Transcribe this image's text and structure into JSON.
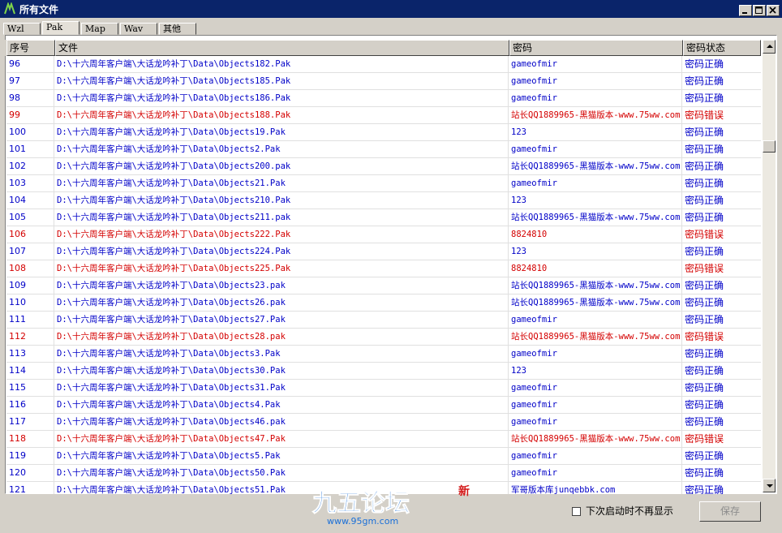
{
  "window": {
    "title": "所有文件"
  },
  "tabs": [
    "Wzl",
    "Pak",
    "Map",
    "Wav",
    "其他"
  ],
  "active_tab": 1,
  "columns": [
    "序号",
    "文件",
    "密码",
    "密码状态"
  ],
  "colors": {
    "ok": "#0000c8",
    "bad": "#d40000"
  },
  "rows": [
    {
      "no": "96",
      "file": "D:\\十六周年客户端\\大话龙吟补丁\\Data\\Objects182.Pak",
      "pwd": "gameofmir",
      "status": "密码正确",
      "ok": true
    },
    {
      "no": "97",
      "file": "D:\\十六周年客户端\\大话龙吟补丁\\Data\\Objects185.Pak",
      "pwd": "gameofmir",
      "status": "密码正确",
      "ok": true
    },
    {
      "no": "98",
      "file": "D:\\十六周年客户端\\大话龙吟补丁\\Data\\Objects186.Pak",
      "pwd": "gameofmir",
      "status": "密码正确",
      "ok": true
    },
    {
      "no": "99",
      "file": "D:\\十六周年客户端\\大话龙吟补丁\\Data\\Objects188.Pak",
      "pwd": "站长QQ1889965-黑猫版本-www.75ww.com",
      "status": "密码错误",
      "ok": false
    },
    {
      "no": "100",
      "file": "D:\\十六周年客户端\\大话龙吟补丁\\Data\\Objects19.Pak",
      "pwd": "123",
      "status": "密码正确",
      "ok": true
    },
    {
      "no": "101",
      "file": "D:\\十六周年客户端\\大话龙吟补丁\\Data\\Objects2.Pak",
      "pwd": "gameofmir",
      "status": "密码正确",
      "ok": true
    },
    {
      "no": "102",
      "file": "D:\\十六周年客户端\\大话龙吟补丁\\Data\\Objects200.pak",
      "pwd": "站长QQ1889965-黑猫版本-www.75ww.com",
      "status": "密码正确",
      "ok": true
    },
    {
      "no": "103",
      "file": "D:\\十六周年客户端\\大话龙吟补丁\\Data\\Objects21.Pak",
      "pwd": "gameofmir",
      "status": "密码正确",
      "ok": true
    },
    {
      "no": "104",
      "file": "D:\\十六周年客户端\\大话龙吟补丁\\Data\\Objects210.Pak",
      "pwd": "123",
      "status": "密码正确",
      "ok": true
    },
    {
      "no": "105",
      "file": "D:\\十六周年客户端\\大话龙吟补丁\\Data\\Objects211.pak",
      "pwd": "站长QQ1889965-黑猫版本-www.75ww.com",
      "status": "密码正确",
      "ok": true
    },
    {
      "no": "106",
      "file": "D:\\十六周年客户端\\大话龙吟补丁\\Data\\Objects222.Pak",
      "pwd": "8824810",
      "status": "密码错误",
      "ok": false
    },
    {
      "no": "107",
      "file": "D:\\十六周年客户端\\大话龙吟补丁\\Data\\Objects224.Pak",
      "pwd": "123",
      "status": "密码正确",
      "ok": true
    },
    {
      "no": "108",
      "file": "D:\\十六周年客户端\\大话龙吟补丁\\Data\\Objects225.Pak",
      "pwd": "8824810",
      "status": "密码错误",
      "ok": false
    },
    {
      "no": "109",
      "file": "D:\\十六周年客户端\\大话龙吟补丁\\Data\\Objects23.pak",
      "pwd": "站长QQ1889965-黑猫版本-www.75ww.com",
      "status": "密码正确",
      "ok": true
    },
    {
      "no": "110",
      "file": "D:\\十六周年客户端\\大话龙吟补丁\\Data\\Objects26.pak",
      "pwd": "站长QQ1889965-黑猫版本-www.75ww.com",
      "status": "密码正确",
      "ok": true
    },
    {
      "no": "111",
      "file": "D:\\十六周年客户端\\大话龙吟补丁\\Data\\Objects27.Pak",
      "pwd": "gameofmir",
      "status": "密码正确",
      "ok": true
    },
    {
      "no": "112",
      "file": "D:\\十六周年客户端\\大话龙吟补丁\\Data\\Objects28.pak",
      "pwd": "站长QQ1889965-黑猫版本-www.75ww.com",
      "status": "密码错误",
      "ok": false
    },
    {
      "no": "113",
      "file": "D:\\十六周年客户端\\大话龙吟补丁\\Data\\Objects3.Pak",
      "pwd": "gameofmir",
      "status": "密码正确",
      "ok": true
    },
    {
      "no": "114",
      "file": "D:\\十六周年客户端\\大话龙吟补丁\\Data\\Objects30.Pak",
      "pwd": "123",
      "status": "密码正确",
      "ok": true
    },
    {
      "no": "115",
      "file": "D:\\十六周年客户端\\大话龙吟补丁\\Data\\Objects31.Pak",
      "pwd": "gameofmir",
      "status": "密码正确",
      "ok": true
    },
    {
      "no": "116",
      "file": "D:\\十六周年客户端\\大话龙吟补丁\\Data\\Objects4.Pak",
      "pwd": "gameofmir",
      "status": "密码正确",
      "ok": true
    },
    {
      "no": "117",
      "file": "D:\\十六周年客户端\\大话龙吟补丁\\Data\\Objects46.pak",
      "pwd": "gameofmir",
      "status": "密码正确",
      "ok": true
    },
    {
      "no": "118",
      "file": "D:\\十六周年客户端\\大话龙吟补丁\\Data\\Objects47.Pak",
      "pwd": "站长QQ1889965-黑猫版本-www.75ww.com",
      "status": "密码错误",
      "ok": false
    },
    {
      "no": "119",
      "file": "D:\\十六周年客户端\\大话龙吟补丁\\Data\\Objects5.Pak",
      "pwd": "gameofmir",
      "status": "密码正确",
      "ok": true
    },
    {
      "no": "120",
      "file": "D:\\十六周年客户端\\大话龙吟补丁\\Data\\Objects50.Pak",
      "pwd": "gameofmir",
      "status": "密码正确",
      "ok": true
    },
    {
      "no": "121",
      "file": "D:\\十六周年客户端\\大话龙吟补丁\\Data\\Objects51.Pak",
      "pwd": "军哥版本库junqebbk.com",
      "status": "密码正确",
      "ok": true
    }
  ],
  "footer": {
    "checkbox_label": "下次启动时不再显示",
    "checkbox_checked": false,
    "save_label": "保存"
  },
  "watermark": {
    "text": "九五论坛",
    "url": "www.95gm.com",
    "badge": "新"
  }
}
